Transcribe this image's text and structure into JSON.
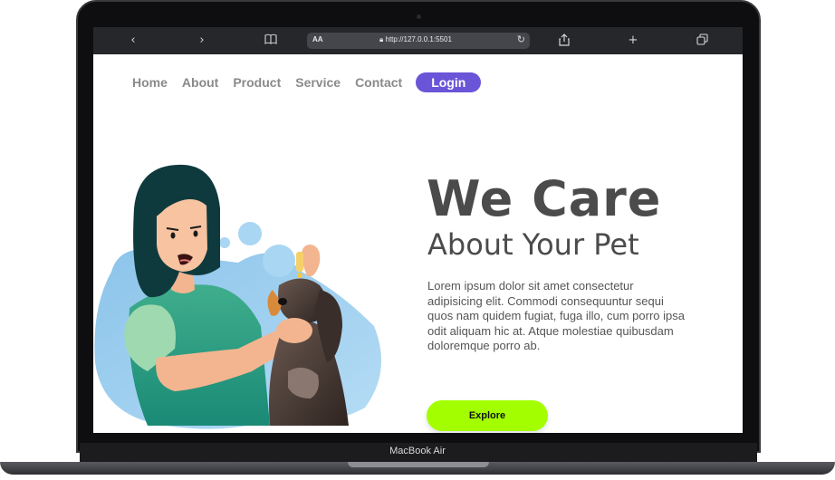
{
  "device": {
    "brand_label": "MacBook Air"
  },
  "browser": {
    "text_size_label": "AA",
    "url": "http://127.0.0.1:5501",
    "icons": {
      "back": "chevron-left-icon",
      "forward": "chevron-right-icon",
      "bookmarks": "book-icon",
      "lock": "lock-icon",
      "reload": "reload-icon",
      "share": "share-icon",
      "new_tab": "plus-icon",
      "tabs": "tabs-icon"
    }
  },
  "nav": {
    "links": [
      "Home",
      "About",
      "Product",
      "Service",
      "Contact"
    ],
    "login_label": "Login"
  },
  "hero": {
    "title": "We Care",
    "subtitle": "About Your Pet",
    "paragraph": "Lorem ipsum dolor sit amet consectetur adipisicing elit. Commodi consequuntur sequi quos nam quidem fugiat, fuga illo, cum porro ipsa odit aliquam hic at. Atque molestiae quibusdam doloremque porro ab.",
    "cta_label": "Explore"
  },
  "colors": {
    "accent": "#6a55d8",
    "cta": "#a3ff00",
    "heading": "#4b4b4b",
    "blob": "#8cc4ea"
  }
}
